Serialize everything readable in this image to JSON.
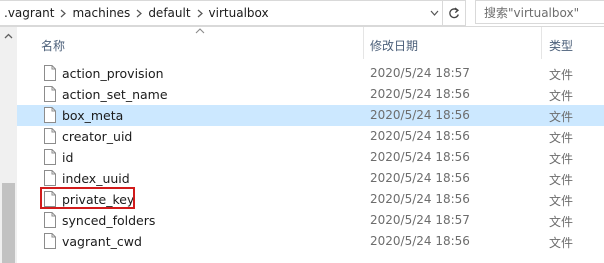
{
  "breadcrumb": {
    "items": [
      ".vagrant",
      "machines",
      "default",
      "virtualbox"
    ]
  },
  "search": {
    "placeholder": "搜索\"virtualbox\""
  },
  "columns": {
    "name": "名称",
    "modified": "修改日期",
    "type": "类型"
  },
  "files": [
    {
      "name": "action_provision",
      "modified": "2020/5/24 18:57",
      "type": "文件"
    },
    {
      "name": "action_set_name",
      "modified": "2020/5/24 18:56",
      "type": "文件"
    },
    {
      "name": "box_meta",
      "modified": "2020/5/24 18:56",
      "type": "文件"
    },
    {
      "name": "creator_uid",
      "modified": "2020/5/24 18:56",
      "type": "文件"
    },
    {
      "name": "id",
      "modified": "2020/5/24 18:56",
      "type": "文件"
    },
    {
      "name": "index_uuid",
      "modified": "2020/5/24 18:56",
      "type": "文件"
    },
    {
      "name": "private_key",
      "modified": "2020/5/24 18:56",
      "type": "文件"
    },
    {
      "name": "synced_folders",
      "modified": "2020/5/24 18:57",
      "type": "文件"
    },
    {
      "name": "vagrant_cwd",
      "modified": "2020/5/24 18:56",
      "type": "文件"
    }
  ],
  "selected_file": "box_meta",
  "highlighted_file": "private_key",
  "colors": {
    "selection": "#cce8ff",
    "highlight_border": "#d11b1b",
    "header_text": "#4c607a"
  }
}
